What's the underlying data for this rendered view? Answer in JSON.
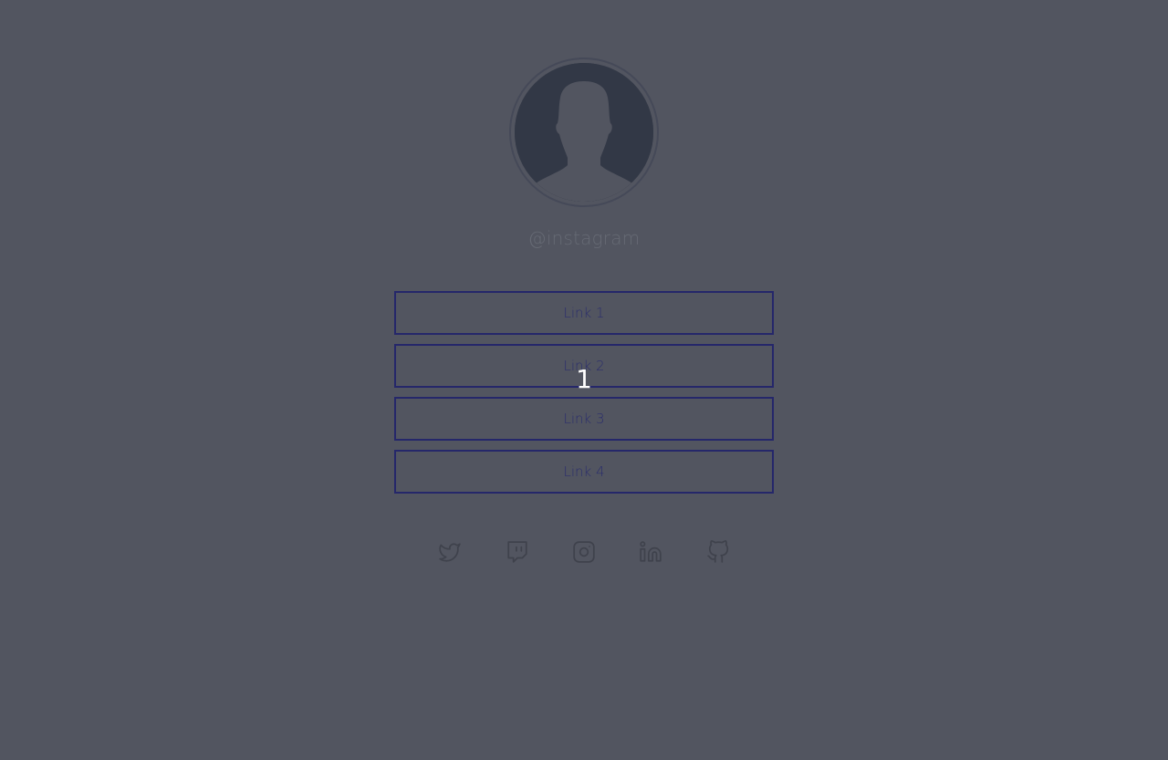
{
  "profile": {
    "username": "@instagram",
    "avatar_icon": "user-silhouette-icon"
  },
  "links": [
    {
      "label": "Link 1"
    },
    {
      "label": "Link 2"
    },
    {
      "label": "Link 3"
    },
    {
      "label": "Link 4"
    }
  ],
  "overlay": {
    "marker": "1"
  },
  "social": [
    {
      "icon": "twitter-icon"
    },
    {
      "icon": "twitch-icon"
    },
    {
      "icon": "instagram-icon"
    },
    {
      "icon": "linkedin-icon"
    },
    {
      "icon": "github-icon"
    }
  ],
  "colors": {
    "background": "#525560",
    "link_border": "#25276a",
    "link_text": "#2b2e6c",
    "username_text": "#666a74",
    "icon_stroke": "#3f424c"
  }
}
